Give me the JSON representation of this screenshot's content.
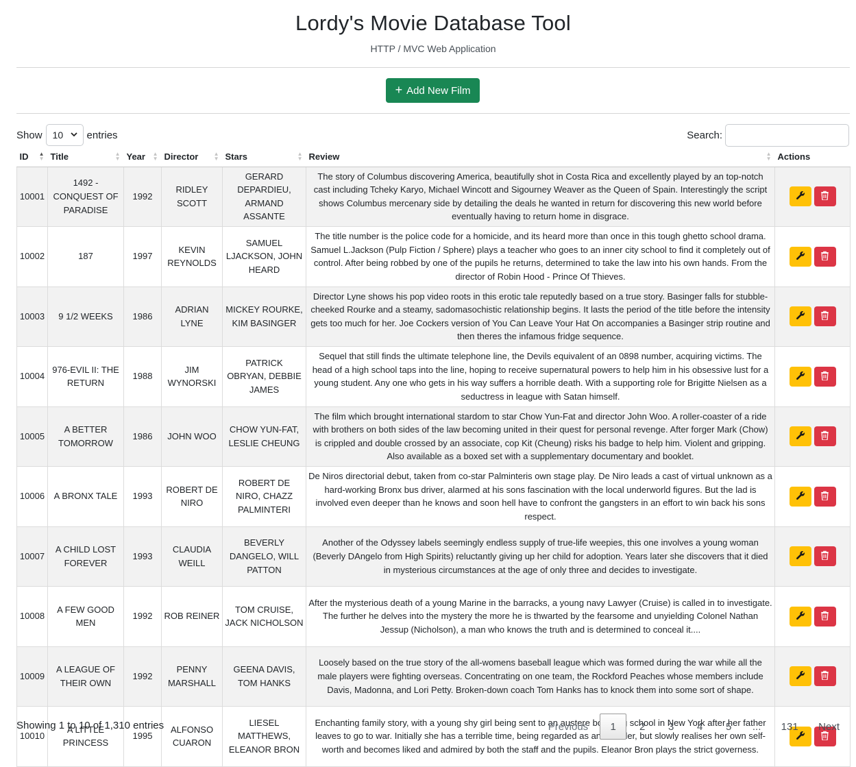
{
  "header": {
    "title": "Lordy's Movie Database Tool",
    "subtitle": "HTTP / MVC Web Application"
  },
  "add_button": {
    "label": "Add New Film",
    "icon": "plus-icon",
    "color": "#198754"
  },
  "length_control": {
    "prefix": "Show",
    "selected": "10",
    "suffix": "entries"
  },
  "search": {
    "label": "Search:",
    "value": ""
  },
  "table": {
    "columns": [
      "ID",
      "Title",
      "Year",
      "Director",
      "Stars",
      "Review",
      "Actions"
    ],
    "rows": [
      {
        "id": "10001",
        "title": "1492 - CONQUEST OF PARADISE",
        "year": "1992",
        "director": "RIDLEY SCOTT",
        "stars": "GERARD DEPARDIEU, ARMAND ASSANTE",
        "review": "The story of Columbus discovering America, beautifully shot in Costa Rica and excellently played by an top-notch cast including Tcheky Karyo, Michael Wincott and Sigourney Weaver as the Queen of Spain. Interestingly the script shows Columbus mercenary side by detailing the deals he wanted in return for discovering this new world before eventually having to return home in disgrace."
      },
      {
        "id": "10002",
        "title": "187",
        "year": "1997",
        "director": "KEVIN REYNOLDS",
        "stars": "SAMUEL LJACKSON, JOHN HEARD",
        "review": "The title number is the police code for a homicide, and its heard more than once in this tough ghetto school drama. Samuel L.Jackson (Pulp Fiction / Sphere) plays a teacher who goes to an inner city school to find it completely out of control. After being robbed by one of the pupils he returns, determined to take the law into his own hands. From the director of Robin Hood - Prince Of Thieves."
      },
      {
        "id": "10003",
        "title": "9 1/2 WEEKS",
        "year": "1986",
        "director": "ADRIAN LYNE",
        "stars": "MICKEY ROURKE, KIM BASINGER",
        "review": "Director Lyne shows his pop video roots in this erotic tale reputedly based on a true story. Basinger falls for stubble-cheeked Rourke and a steamy, sadomasochistic relationship begins. It lasts the period of the title before the intensity gets too much for her. Joe Cockers version of You Can Leave Your Hat On accompanies a Basinger strip routine and then theres the infamous fridge sequence."
      },
      {
        "id": "10004",
        "title": "976-EVIL II: THE RETURN",
        "year": "1988",
        "director": "JIM WYNORSKI",
        "stars": "PATRICK OBRYAN, DEBBIE JAMES",
        "review": "Sequel that still finds the ultimate telephone line, the Devils equivalent of an 0898 number, acquiring victims. The head of a high school taps into the line, hoping to receive supernatural powers to help him in his obsessive lust for a young student. Any one who gets in his way suffers a horrible death. With a supporting role for Brigitte Nielsen as a seductress in league with Satan himself."
      },
      {
        "id": "10005",
        "title": "A BETTER TOMORROW",
        "year": "1986",
        "director": "JOHN WOO",
        "stars": "CHOW YUN-FAT, LESLIE CHEUNG",
        "review": "The film which brought international stardom to star Chow Yun-Fat and director John Woo. A roller-coaster of a ride with brothers on both sides of the law becoming united in their quest for personal revenge. After forger Mark (Chow) is crippled and double crossed by an associate, cop Kit (Cheung) risks his badge to help him. Violent and gripping. Also available as a boxed set with a supplementary documentary and booklet."
      },
      {
        "id": "10006",
        "title": "A BRONX TALE",
        "year": "1993",
        "director": "ROBERT DE NIRO",
        "stars": "ROBERT DE NIRO, CHAZZ PALMINTERI",
        "review": "De Niros directorial debut, taken from co-star Palminteris own stage play. De Niro leads a cast of virtual unknown as a hard-working Bronx bus driver, alarmed at his sons fascination with the local underworld figures. But the lad is involved even deeper than he knows and soon hell have to confront the gangsters in an effort to win back his sons respect."
      },
      {
        "id": "10007",
        "title": "A CHILD LOST FOREVER",
        "year": "1993",
        "director": "CLAUDIA WEILL",
        "stars": "BEVERLY DANGELO, WILL PATTON",
        "review": "Another of the Odyssey labels seemingly endless supply of true-life weepies, this one involves a young woman (Beverly DAngelo from High Spirits) reluctantly giving up her child for adoption. Years later she discovers that it died in mysterious circumstances at the age of only three and decides to investigate."
      },
      {
        "id": "10008",
        "title": "A FEW GOOD MEN",
        "year": "1992",
        "director": "ROB REINER",
        "stars": "TOM CRUISE, JACK NICHOLSON",
        "review": "After the mysterious death of a young Marine in the barracks, a young navy Lawyer (Cruise) is called in to investigate. The further he delves into the mystery the more he is thwarted by the fearsome and unyielding Colonel Nathan Jessup (Nicholson), a man who knows the truth and is determined to conceal it...."
      },
      {
        "id": "10009",
        "title": "A LEAGUE OF THEIR OWN",
        "year": "1992",
        "director": "PENNY MARSHALL",
        "stars": "GEENA DAVIS, TOM HANKS",
        "review": "Loosely based on the true story of the all-womens baseball league which was formed during the war while all the male players were fighting overseas. Concentrating on one team, the Rockford Peaches whose members include Davis, Madonna, and Lori Petty. Broken-down coach Tom Hanks has to knock them into some sort of shape."
      },
      {
        "id": "10010",
        "title": "A LITTLE PRINCESS",
        "year": "1995",
        "director": "ALFONSO CUARON",
        "stars": "LIESEL MATTHEWS, ELEANOR BRON",
        "review": "Enchanting family story, with a young shy girl being sent to an austere boarding school in New York after her father leaves to go to war. Initially she has a terrible time, being regarded as an outsider, but slowly realises her own self-worth and becomes liked and admired by both the staff and the pupils. Eleanor Bron plays the strict governess."
      }
    ],
    "edit_icon": "wrench-icon",
    "delete_icon": "trash-icon",
    "edit_color": "#ffc107",
    "delete_color": "#dc3545"
  },
  "footer": {
    "info": "Showing 1 to 10 of 1,310 entries",
    "pagination": {
      "previous": "Previous",
      "pages": [
        "1",
        "2",
        "3",
        "4",
        "5"
      ],
      "ellipsis": "...",
      "last": "131",
      "next": "Next",
      "current": "1"
    }
  }
}
